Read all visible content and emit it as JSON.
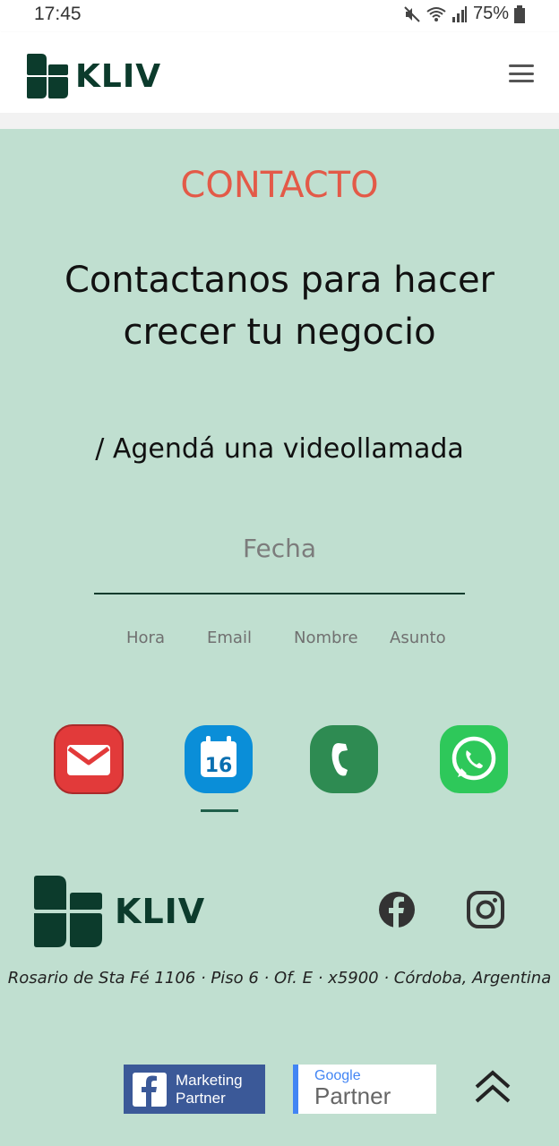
{
  "status_bar": {
    "time": "17:45",
    "battery": "75%",
    "icons": [
      "mute-icon",
      "wifi-icon",
      "signal-icon",
      "battery-icon"
    ]
  },
  "header": {
    "brand": "KLIV",
    "menu_icon": "hamburger-menu-icon"
  },
  "contact": {
    "section_label": "CONTACTO",
    "headline": "Contactanos para hacer crecer tu negocio",
    "subhead": "/ Agendá una videollamada",
    "date_placeholder": "Fecha",
    "fields": [
      "Hora",
      "Email",
      "Nombre",
      "Asunto"
    ],
    "channels": [
      {
        "name": "email",
        "icon": "email-icon"
      },
      {
        "name": "calendar",
        "icon": "calendar-icon",
        "label": "16",
        "active": true
      },
      {
        "name": "phone",
        "icon": "phone-icon"
      },
      {
        "name": "whatsapp",
        "icon": "whatsapp-icon"
      }
    ]
  },
  "footer": {
    "brand": "KLIV",
    "social": [
      "facebook-icon",
      "instagram-icon"
    ],
    "address": "Rosario de Sta Fé 1106 · Piso 6 · Of. E · x5900 · Córdoba, Argentina",
    "badges": {
      "facebook_line1": "Marketing",
      "facebook_line2": "Partner",
      "google_line1": "Google",
      "google_line2": "Partner"
    },
    "scroll_top_icon": "double-chevron-up-icon"
  },
  "colors": {
    "background": "#c0dfd0",
    "brand_green": "#0c3b2c",
    "accent_red": "#e35a48",
    "facebook_blue": "#3b5998",
    "google_blue": "#4285f4"
  }
}
